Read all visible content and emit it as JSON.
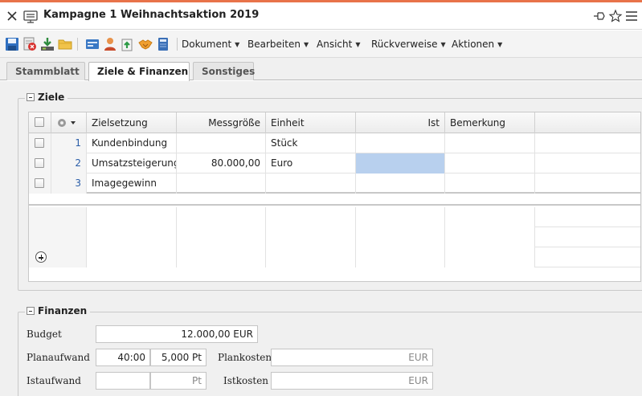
{
  "window": {
    "title": "Kampagne 1 Weihnachtsaktion 2019"
  },
  "toolbar": {
    "menus": [
      {
        "label": "Dokument"
      },
      {
        "label": "Bearbeiten"
      },
      {
        "label": "Ansicht"
      },
      {
        "label": "Rückverweise"
      },
      {
        "label": "Aktionen"
      }
    ],
    "icons": [
      "save-icon",
      "delete-icon",
      "download-icon",
      "folder-icon",
      "card-icon",
      "person-icon",
      "export-icon",
      "handshake-icon",
      "notebook-icon"
    ]
  },
  "tabs": [
    {
      "label": "Stammblatt",
      "active": false
    },
    {
      "label": "Ziele & Finanzen",
      "active": true
    },
    {
      "label": "Sonstiges",
      "active": false
    }
  ],
  "ziele": {
    "legend": "Ziele",
    "columns": [
      "Zielsetzung",
      "Messgröße",
      "Einheit",
      "Ist",
      "Bemerkung"
    ],
    "rows": [
      {
        "idx": "1",
        "zielsetzung": "Kundenbindung",
        "messgroesse": "",
        "einheit": "Stück",
        "ist": "",
        "bemerkung": ""
      },
      {
        "idx": "2",
        "zielsetzung": "Umsatzsteigerung",
        "messgroesse": "80.000,00",
        "einheit": "Euro",
        "ist": "",
        "bemerkung": ""
      },
      {
        "idx": "3",
        "zielsetzung": "Imagegewinn",
        "messgroesse": "",
        "einheit": "",
        "ist": "",
        "bemerkung": ""
      }
    ]
  },
  "finanzen": {
    "legend": "Finanzen",
    "budget_label": "Budget",
    "budget_value": "12.000,00 EUR",
    "planaufwand_label": "Planaufwand",
    "planaufwand_time": "40:00",
    "planaufwand_pt": "5,000 Pt",
    "plankosten_label": "Plankosten",
    "plankosten_unit": "EUR",
    "istaufwand_label": "Istaufwand",
    "istaufwand_time": "",
    "istaufwand_pt_unit": "Pt",
    "istkosten_label": "Istkosten",
    "istkosten_unit": "EUR"
  },
  "colors": {
    "accent_line": "#e8734a",
    "selection": "#b8d0ee",
    "index_blue": "#2a5da8"
  }
}
